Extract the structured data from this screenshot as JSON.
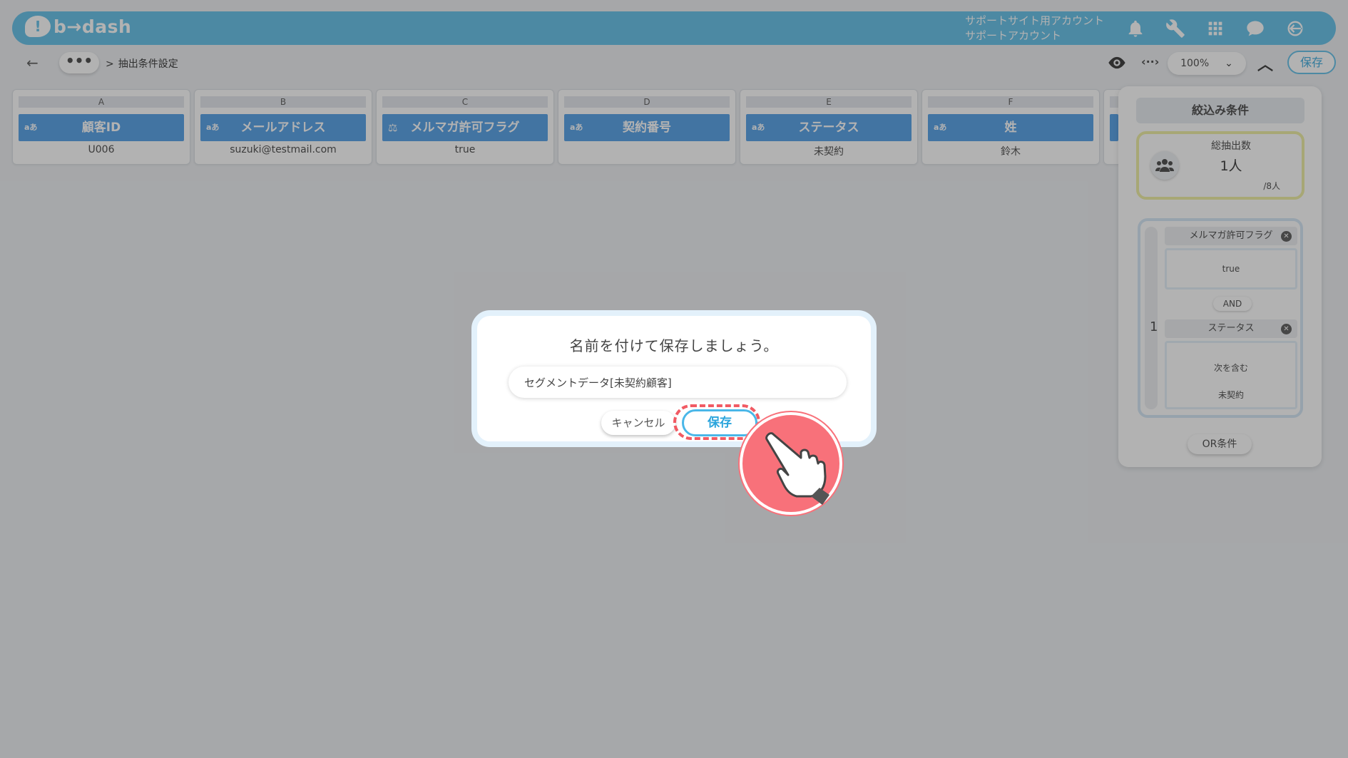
{
  "header": {
    "logo_mark": "!",
    "logo_text": "b→dash",
    "account_line1": "サポートサイト用アカウント",
    "account_line2": "サポートアカウント"
  },
  "toolbar": {
    "back": "←",
    "more": "•••",
    "breadcrumb_sep": ">",
    "breadcrumb": "抽出条件設定",
    "code": "‹··›",
    "zoom": "100%",
    "save": "保存"
  },
  "columns": [
    {
      "letter": "A",
      "type": "aあ",
      "name": "顧客ID",
      "value": "U006"
    },
    {
      "letter": "B",
      "type": "aあ",
      "name": "メールアドレス",
      "value": "suzuki@testmail.com"
    },
    {
      "letter": "C",
      "type": "⚖",
      "name": "メルマガ許可フラグ",
      "value": "true"
    },
    {
      "letter": "D",
      "type": "aあ",
      "name": "契約番号",
      "value": ""
    },
    {
      "letter": "E",
      "type": "aあ",
      "name": "ステータス",
      "value": "未契約"
    },
    {
      "letter": "F",
      "type": "aあ",
      "name": "姓",
      "value": "鈴木"
    }
  ],
  "panel": {
    "title": "絞込み条件",
    "count_label": "総抽出数",
    "count_value": "1人",
    "count_total": "/8人",
    "group_number": "1",
    "conditions": [
      {
        "field": "メルマガ許可フラグ",
        "values": [
          "true"
        ]
      },
      {
        "field": "ステータス",
        "values": [
          "次を含む",
          "未契約"
        ]
      }
    ],
    "and_label": "AND",
    "or_button": "OR条件"
  },
  "dialog": {
    "title": "名前を付けて保存しましょう。",
    "input_value": "セグメントデータ[未契約顧客]",
    "cancel": "キャンセル",
    "save": "保存"
  },
  "colors": {
    "header": "#6ec4ea",
    "column_header": "#5fa6e8",
    "highlight": "#f15a63",
    "accent": "#4ab7e8"
  }
}
